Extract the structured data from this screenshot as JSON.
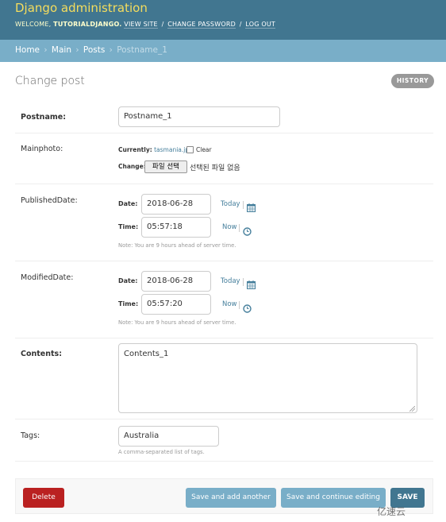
{
  "header": {
    "branding": "Django administration",
    "welcome_prefix": "WELCOME,",
    "username": "TUTORIALDJANGO.",
    "view_site": "VIEW SITE",
    "change_password": "CHANGE PASSWORD",
    "log_out": "LOG OUT",
    "separator": "/"
  },
  "breadcrumbs": {
    "items": [
      "Home",
      "Main",
      "Posts"
    ],
    "current": "Postname_1",
    "arrow": "›"
  },
  "page": {
    "title": "Change post",
    "history_label": "HISTORY"
  },
  "form": {
    "postname": {
      "label": "Postname:",
      "value": "Postname_1"
    },
    "mainphoto": {
      "label": "Mainphoto:",
      "currently_label": "Currently:",
      "current_file": "tasmania.jpg",
      "clear_label": "Clear",
      "change_label": "Change:",
      "choose_button": "파일 선택",
      "no_file_text": "선택된 파일 없음"
    },
    "published_date": {
      "label": "PublishedDate:",
      "date_label": "Date:",
      "date_value": "2018-06-28",
      "today_link": "Today",
      "time_label": "Time:",
      "time_value": "05:57:18",
      "now_link": "Now",
      "note": "Note: You are 9 hours ahead of server time."
    },
    "modified_date": {
      "label": "ModifiedDate:",
      "date_label": "Date:",
      "date_value": "2018-06-28",
      "today_link": "Today",
      "time_label": "Time:",
      "time_value": "05:57:20",
      "now_link": "Now",
      "note": "Note: You are 9 hours ahead of server time."
    },
    "contents": {
      "label": "Contents:",
      "value": "Contents_1"
    },
    "tags": {
      "label": "Tags:",
      "value": "Australia",
      "help": "A comma-separated list of tags."
    }
  },
  "actions": {
    "delete": "Delete",
    "save_add_another": "Save and add another",
    "save_continue": "Save and continue editing",
    "save": "SAVE"
  },
  "icons": {
    "calendar": "calendar-icon",
    "clock": "clock-icon"
  },
  "colors": {
    "header_bg": "#417690",
    "branding": "#f5dd5d",
    "breadcrumb_bg": "#79aec8",
    "delete": "#ba2121",
    "secondary_button": "#79aec8",
    "primary_button": "#417690",
    "link": "#447e9b"
  },
  "watermark": "亿速云"
}
